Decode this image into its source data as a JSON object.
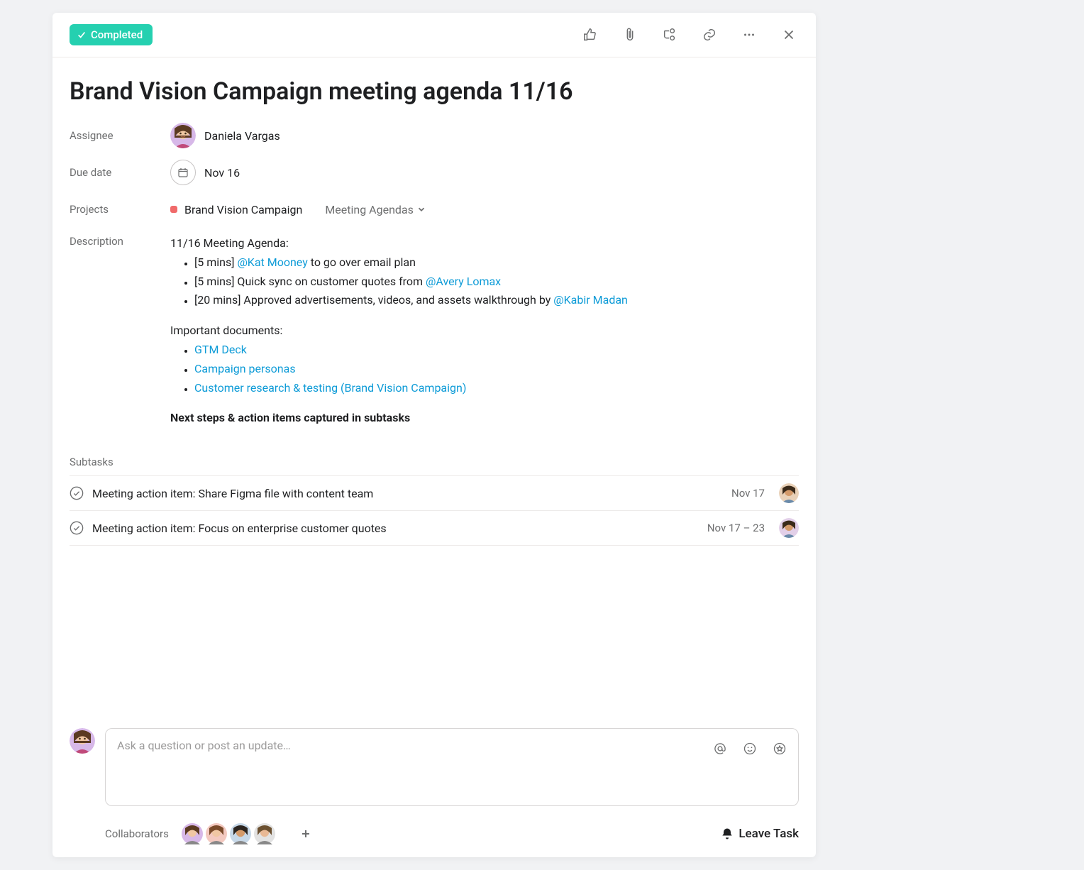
{
  "toolbar": {
    "completed_label": "Completed"
  },
  "task": {
    "title": "Brand Vision Campaign meeting agenda 11/16",
    "assignee_label": "Assignee",
    "assignee_name": "Daniela Vargas",
    "due_date_label": "Due date",
    "due_date_value": "Nov 16",
    "projects_label": "Projects",
    "project_name": "Brand Vision Campaign",
    "project_section": "Meeting Agendas",
    "description_label": "Description"
  },
  "description": {
    "heading": "11/16 Meeting Agenda:",
    "items": [
      {
        "prefix": "[5 mins] ",
        "mention": "@Kat Mooney",
        "suffix": " to go over email plan"
      },
      {
        "prefix": "[5 mins] Quick sync on customer quotes from ",
        "mention": "@Avery Lomax",
        "suffix": ""
      },
      {
        "prefix": "[20 mins] Approved advertisements, videos, and assets walkthrough by ",
        "mention": "@Kabir Madan",
        "suffix": ""
      }
    ],
    "docs_heading": "Important documents:",
    "docs": [
      "GTM Deck",
      "Campaign personas",
      "Customer research & testing (Brand Vision Campaign)"
    ],
    "footer": "Next steps & action items captured in subtasks"
  },
  "subtasks": {
    "header": "Subtasks",
    "items": [
      {
        "title": "Meeting action item: Share Figma file with content team",
        "date": "Nov 17",
        "avatar_bg": "#e9d1b8",
        "avatar_skin": "#d49a6a"
      },
      {
        "title": "Meeting action item: Focus on enterprise customer quotes",
        "date": "Nov 17 – 23",
        "avatar_bg": "#e2cfe8",
        "avatar_skin": "#d49a6a"
      }
    ]
  },
  "composer": {
    "placeholder": "Ask a question or post an update…"
  },
  "collaborators": {
    "label": "Collaborators",
    "avatars": [
      {
        "bg": "#d7b8e8",
        "skin": "#f0c7a3",
        "hair": "#5b3a22"
      },
      {
        "bg": "#f3c9c0",
        "skin": "#f0c7a3",
        "hair": "#7a4a2a"
      },
      {
        "bg": "#c7d8e8",
        "skin": "#d49a6a",
        "hair": "#2c2520"
      },
      {
        "bg": "#e2e2e2",
        "skin": "#e8b894",
        "hair": "#6b5030"
      }
    ]
  },
  "leave_task_label": "Leave Task",
  "main_avatar": {
    "bg": "#d7b8e8",
    "skin": "#f0c7a3",
    "hair": "#5b3a22"
  }
}
